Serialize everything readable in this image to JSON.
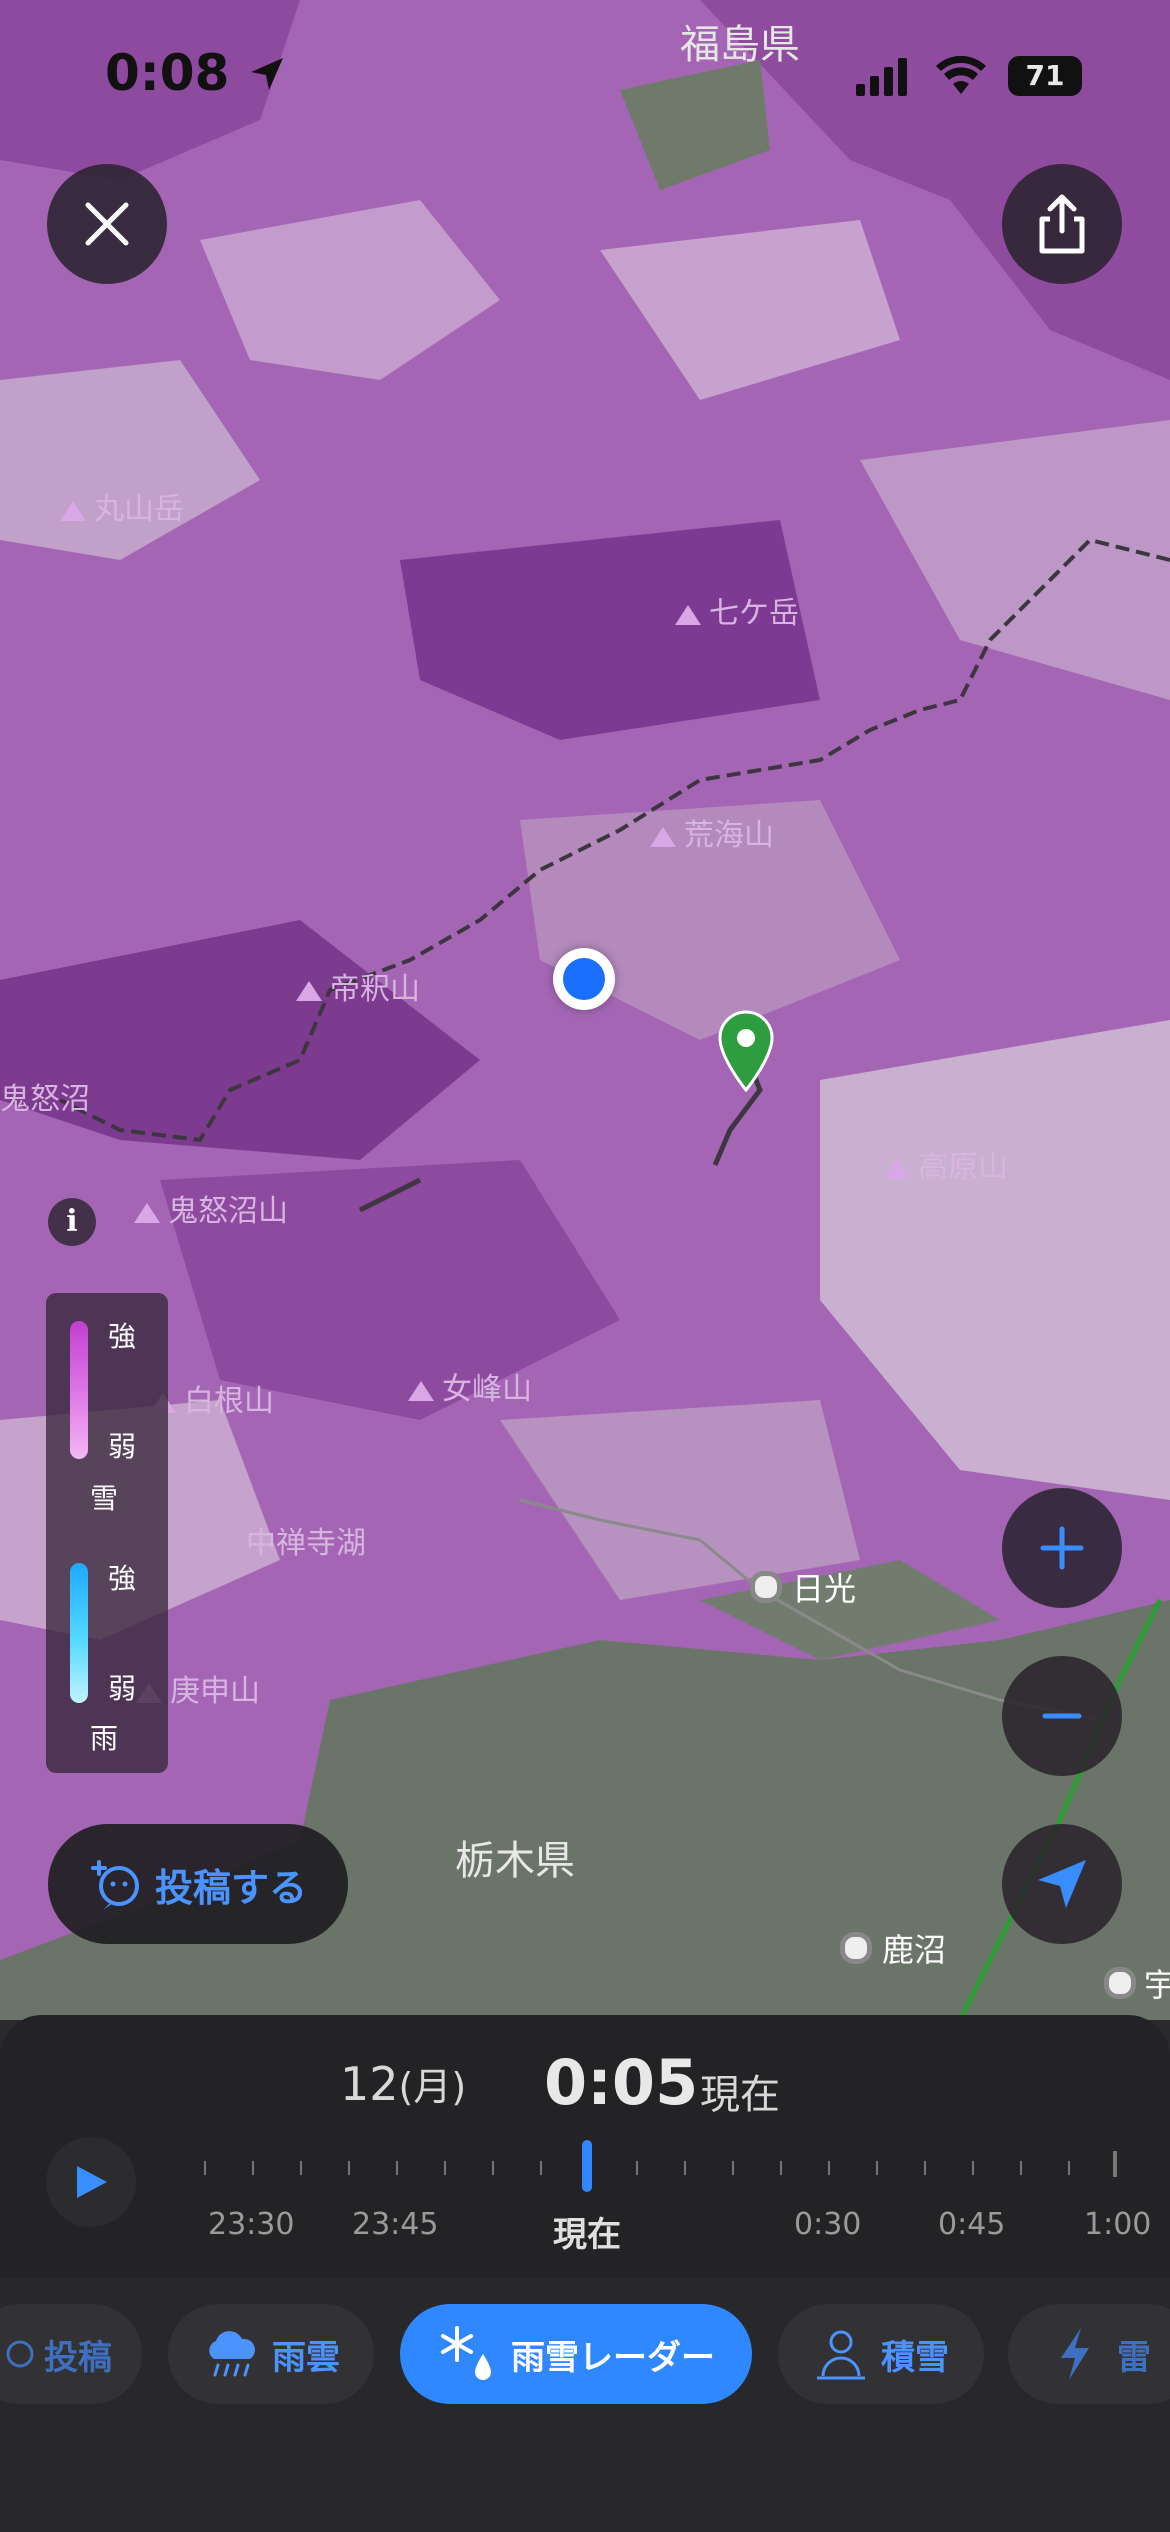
{
  "status_bar": {
    "time": "0:08",
    "battery": "71"
  },
  "map": {
    "prefecture_top": "福島県",
    "prefecture_bottom": "栃木県",
    "peaks": [
      "丸山岳",
      "七ケ岳",
      "荒海山",
      "帝釈山",
      "高原山",
      "鬼怒沼山",
      "白根山",
      "女峰山",
      "庚申山"
    ],
    "lake_labels": [
      "中禅寺湖",
      "鬼怒沼"
    ],
    "cities": [
      "日光",
      "鹿沼"
    ],
    "city_partial": "宇"
  },
  "legend": {
    "snow_strong": "強",
    "snow_weak": "弱",
    "snow_label": "雪",
    "rain_strong": "強",
    "rain_weak": "弱",
    "rain_label": "雨",
    "snow_colors": [
      "#c23fd0",
      "#e07ae8",
      "#f3b7f5"
    ],
    "rain_colors": [
      "#1fa9ff",
      "#55d9ff",
      "#bff4ff"
    ]
  },
  "post_button": {
    "label": "投稿する"
  },
  "timeline": {
    "date": "12",
    "weekday": "(月)",
    "time": "0:05",
    "now_label": "現在",
    "labels": [
      "23:30",
      "23:45",
      "現在",
      "0:30",
      "0:45",
      "1:00"
    ]
  },
  "tabs": [
    {
      "label": "投稿",
      "icon": "post-icon"
    },
    {
      "label": "雨雲",
      "icon": "rain-cloud-icon"
    },
    {
      "label": "雨雪レーダー",
      "icon": "snow-rain-icon"
    },
    {
      "label": "積雪",
      "icon": "snowman-icon"
    },
    {
      "label": "雷",
      "icon": "lightning-icon"
    }
  ],
  "colors": {
    "accent": "#2f88ff",
    "snow_dark": "#7f3d93",
    "snow_light": "#c9a3cf",
    "land": "#6f7a6a"
  }
}
